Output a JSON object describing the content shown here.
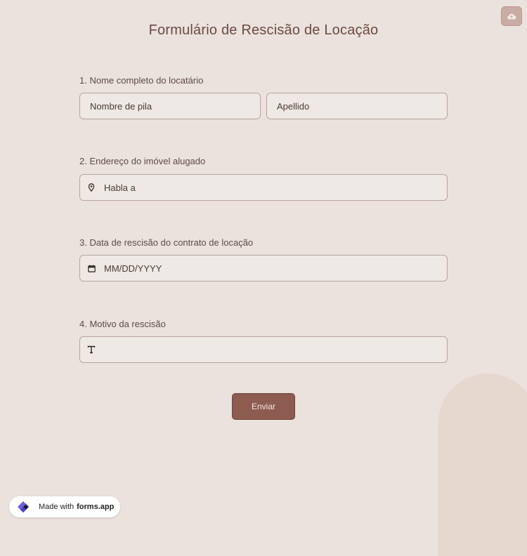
{
  "form": {
    "title": "Formulário de Rescisão de Locação",
    "q1": {
      "label": "1. Nome completo do locatário",
      "first_placeholder": "Nombre de pila",
      "last_placeholder": "Apellido"
    },
    "q2": {
      "label": "2. Endereço do imóvel alugado",
      "placeholder": "Habla a",
      "icon": "location-pin-icon"
    },
    "q3": {
      "label": "3. Data de rescisão do contrato de locação",
      "placeholder": "MM/DD/YYYY",
      "icon": "calendar-icon"
    },
    "q4": {
      "label": "4. Motivo da rescisão",
      "icon": "text-icon",
      "value": ""
    },
    "submit_label": "Enviar"
  },
  "toolbar": {
    "upload_icon": "cloud-upload-icon"
  },
  "footer": {
    "made_with": "Made with",
    "brand": "forms.app"
  },
  "colors": {
    "background": "#ebe2dd",
    "accent": "#8e5b51",
    "field_bg": "#efe9e5"
  }
}
